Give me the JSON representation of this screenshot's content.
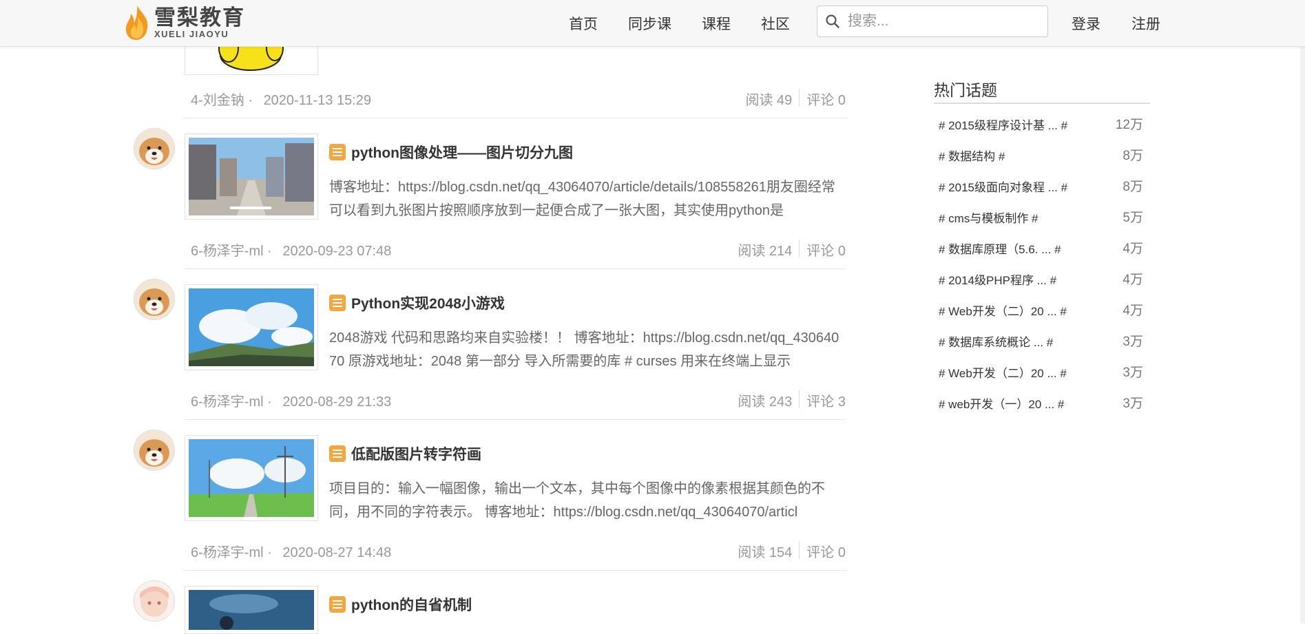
{
  "header": {
    "logo_cn": "雪梨教育",
    "logo_en": "XUELI JIAOYU",
    "nav": [
      "首页",
      "同步课",
      "课程",
      "社区"
    ],
    "search_placeholder": "搜索...",
    "login": "登录",
    "register": "注册"
  },
  "top_post_meta": {
    "author": "4-刘金钠 ·",
    "date": "2020-11-13 15:29",
    "reads": "阅读 49",
    "comments": "评论 0"
  },
  "posts": [
    {
      "title": "python图像处理——图片切分九图",
      "excerpt": "博客地址：https://blog.csdn.net/qq_43064070/article/details/108558261朋友圈经常可以看到九张图片按照顺序放到一起便合成了一张大图，其实使用python是",
      "author": "6-杨泽宇-ml ·",
      "date": "2020-09-23 07:48",
      "reads": "阅读 214",
      "comments": "评论 0"
    },
    {
      "title": "Python实现2048小游戏",
      "excerpt": "2048游戏 代码和思路均来自实验楼！！ 博客地址：https://blog.csdn.net/qq_43064070 原游戏地址：2048 第一部分 导入所需要的库 # curses 用来在终端上显示",
      "author": "6-杨泽宇-ml ·",
      "date": "2020-08-29 21:33",
      "reads": "阅读 243",
      "comments": "评论 3"
    },
    {
      "title": "低配版图片转字符画",
      "excerpt": "项目目的：输入一幅图像，输出一个文本，其中每个图像中的像素根据其颜色的不同，用不同的字符表示。 博客地址：https://blog.csdn.net/qq_43064070/articl",
      "author": "6-杨泽宇-ml ·",
      "date": "2020-08-27 14:48",
      "reads": "阅读 154",
      "comments": "评论 0"
    },
    {
      "title": "python的自省机制"
    }
  ],
  "sidebar": {
    "title": "热门话题",
    "topics": [
      {
        "name": "# 2015级程序设计基 ... #",
        "count": "12万"
      },
      {
        "name": "# 数据结构 #",
        "count": "8万"
      },
      {
        "name": "# 2015级面向对象程 ... #",
        "count": "8万"
      },
      {
        "name": "# cms与模板制作 #",
        "count": "5万"
      },
      {
        "name": "# 数据库原理（5.6. ... #",
        "count": "4万"
      },
      {
        "name": "# 2014级PHP程序 ... #",
        "count": "4万"
      },
      {
        "name": "# Web开发（二）20 ... #",
        "count": "4万"
      },
      {
        "name": "# 数据库系统概论 ... #",
        "count": "3万"
      },
      {
        "name": "# Web开发（二）20 ... #",
        "count": "3万"
      },
      {
        "name": "# web开发（一）20 ... #",
        "count": "3万"
      }
    ]
  },
  "colors": {
    "accent": "#f5a63e",
    "text": "#333333",
    "muted": "#999999"
  }
}
